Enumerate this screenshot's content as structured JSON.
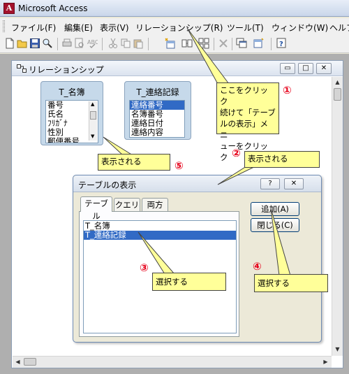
{
  "app": {
    "title": "Microsoft Access",
    "icon": "access-icon",
    "icon_glyph": "A"
  },
  "menu": [
    {
      "label": "ファイル(F)"
    },
    {
      "label": "編集(E)"
    },
    {
      "label": "表示(V)"
    },
    {
      "label": "リレーションシップ(R)"
    },
    {
      "label": "ツール(T)"
    },
    {
      "label": "ウィンドウ(W)"
    },
    {
      "label": "ヘルプ"
    }
  ],
  "toolbar": {
    "icons": [
      "new-icon",
      "open-icon",
      "save-icon",
      "search-icon",
      "print-icon",
      "preview-icon",
      "spell-icon",
      "cut-icon",
      "copy-icon",
      "paste-icon",
      "show-table-icon",
      "show-direct-icon",
      "show-all-icon",
      "delete-icon",
      "window-icon",
      "new-object-icon",
      "help-icon"
    ]
  },
  "relwin": {
    "title": "リレーションシップ",
    "min_glyph": "▭",
    "max_glyph": "□",
    "close_glyph": "✕"
  },
  "table1": {
    "title": "T_名簿",
    "fields": [
      "番号",
      "氏名",
      "ﾌﾘｶﾞﾅ",
      "性別",
      "郵便番号"
    ]
  },
  "table2": {
    "title": "T_連絡記録",
    "fields": [
      "連絡番号",
      "名簿番号",
      "連絡日付",
      "連絡内容"
    ]
  },
  "callouts": {
    "c1": "ここをクリック\n続けて「テーブ\nルの表示」メニ\nューをクリック",
    "c2": "表示される",
    "c3": "選択する",
    "c4": "選択する",
    "c5": "表示される"
  },
  "numbers": {
    "n1": "①",
    "n2": "②",
    "n3": "③",
    "n4": "④",
    "n5": "⑤"
  },
  "dialog": {
    "title": "テーブルの表示",
    "help_glyph": "?",
    "close_glyph": "✕",
    "tabs": [
      "テーブル",
      "クエリ",
      "両方"
    ],
    "items": [
      "T_名簿",
      "T_連絡記録"
    ],
    "add_label": "追加(A)",
    "close_label": "閉じる(C)"
  },
  "colors": {
    "callout": "#ffff99",
    "number": "#e6001a",
    "selection": "#316ac5"
  }
}
